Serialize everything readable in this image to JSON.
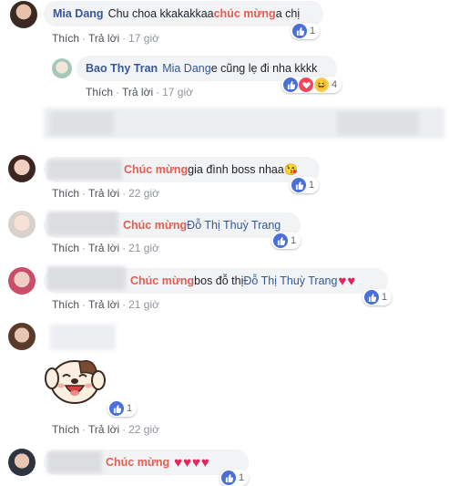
{
  "actions": {
    "like": "Thích",
    "reply": "Trả lời",
    "sep": "·"
  },
  "comments": [
    {
      "name": "Mia Dang",
      "text_before": "Chu choa kkakakkaa ",
      "highlight": "chúc mừng",
      "text_after": " a chị",
      "time": "17 giờ",
      "reactions": "1"
    },
    {
      "name": "Bao Thy Tran",
      "mention": "Mia Dang",
      "text": " e cũng lẹ đi nha kkkk",
      "time": "17 giờ",
      "reactions": "4"
    },
    {
      "highlight": "Chúc mừng",
      "text": " gia đình boss nhaa",
      "emoji": "😘",
      "time": "22 giờ",
      "reactions": "1"
    },
    {
      "highlight": "Chúc mừng",
      "mention": " Đỗ Thị Thuỳ Trang",
      "time": "21 giờ",
      "reactions": "1"
    },
    {
      "highlight": "Chúc mừng",
      "text": " bos đỗ thị ",
      "mention": "Đỗ Thị Thuỳ Trang",
      "time": "21 giờ",
      "reactions": "1"
    },
    {
      "time": "22 giờ",
      "reactions": "1"
    },
    {
      "highlight": "Chúc mừng",
      "reactions": "1"
    }
  ],
  "colors": {
    "link": "#365899",
    "highlight": "#e15e53",
    "like": "#4a6fd8",
    "heart": "#e0245e"
  },
  "icons": [
    "like-icon",
    "love-icon",
    "haha-icon",
    "heart-emoji",
    "kiss-emoji",
    "sticker-laughing-dog"
  ]
}
